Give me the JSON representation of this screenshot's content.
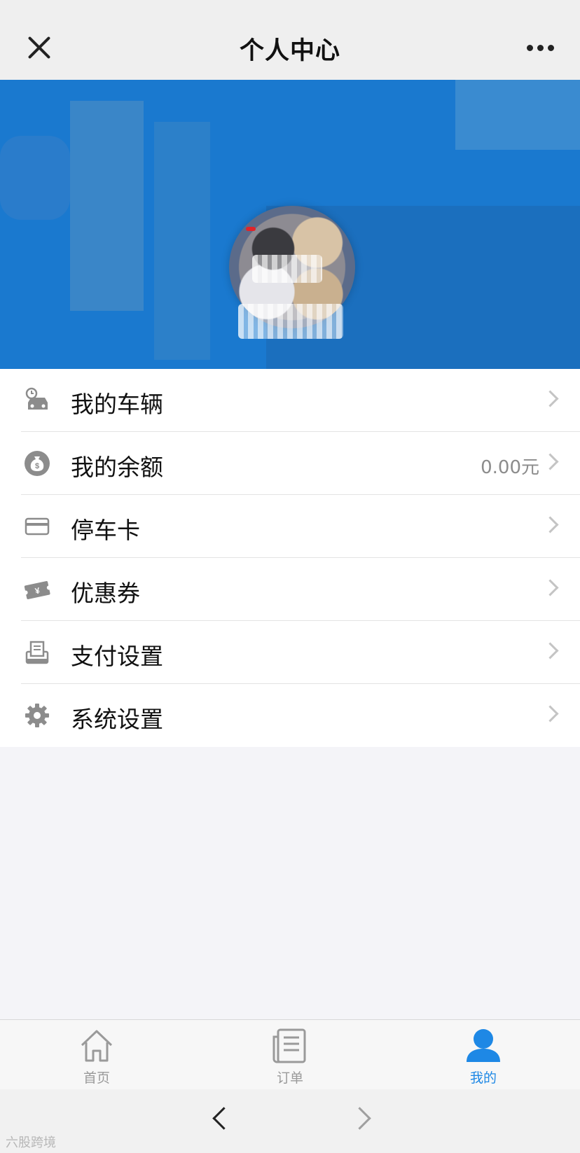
{
  "topbar": {
    "title": "个人中心",
    "close_icon": "close-icon",
    "more_icon": "more-icon"
  },
  "menu": {
    "items": [
      {
        "label": "我的车辆",
        "value": "",
        "icon": "car-icon"
      },
      {
        "label": "我的余额",
        "value": "0.00元",
        "icon": "money-bag-icon"
      },
      {
        "label": "停车卡",
        "value": "",
        "icon": "card-icon"
      },
      {
        "label": "优惠券",
        "value": "",
        "icon": "coupon-icon"
      },
      {
        "label": "支付设置",
        "value": "",
        "icon": "payment-settings-icon"
      },
      {
        "label": "系统设置",
        "value": "",
        "icon": "gear-icon"
      }
    ]
  },
  "tabs": [
    {
      "label": "首页",
      "icon": "home-icon",
      "active": false
    },
    {
      "label": "订单",
      "icon": "order-icon",
      "active": false
    },
    {
      "label": "我的",
      "icon": "user-icon",
      "active": true
    }
  ],
  "watermark": "六股跨境",
  "colors": {
    "banner": "#1a79cf",
    "active_tab": "#1e88e5",
    "icon_gray": "#8c8c8c"
  }
}
